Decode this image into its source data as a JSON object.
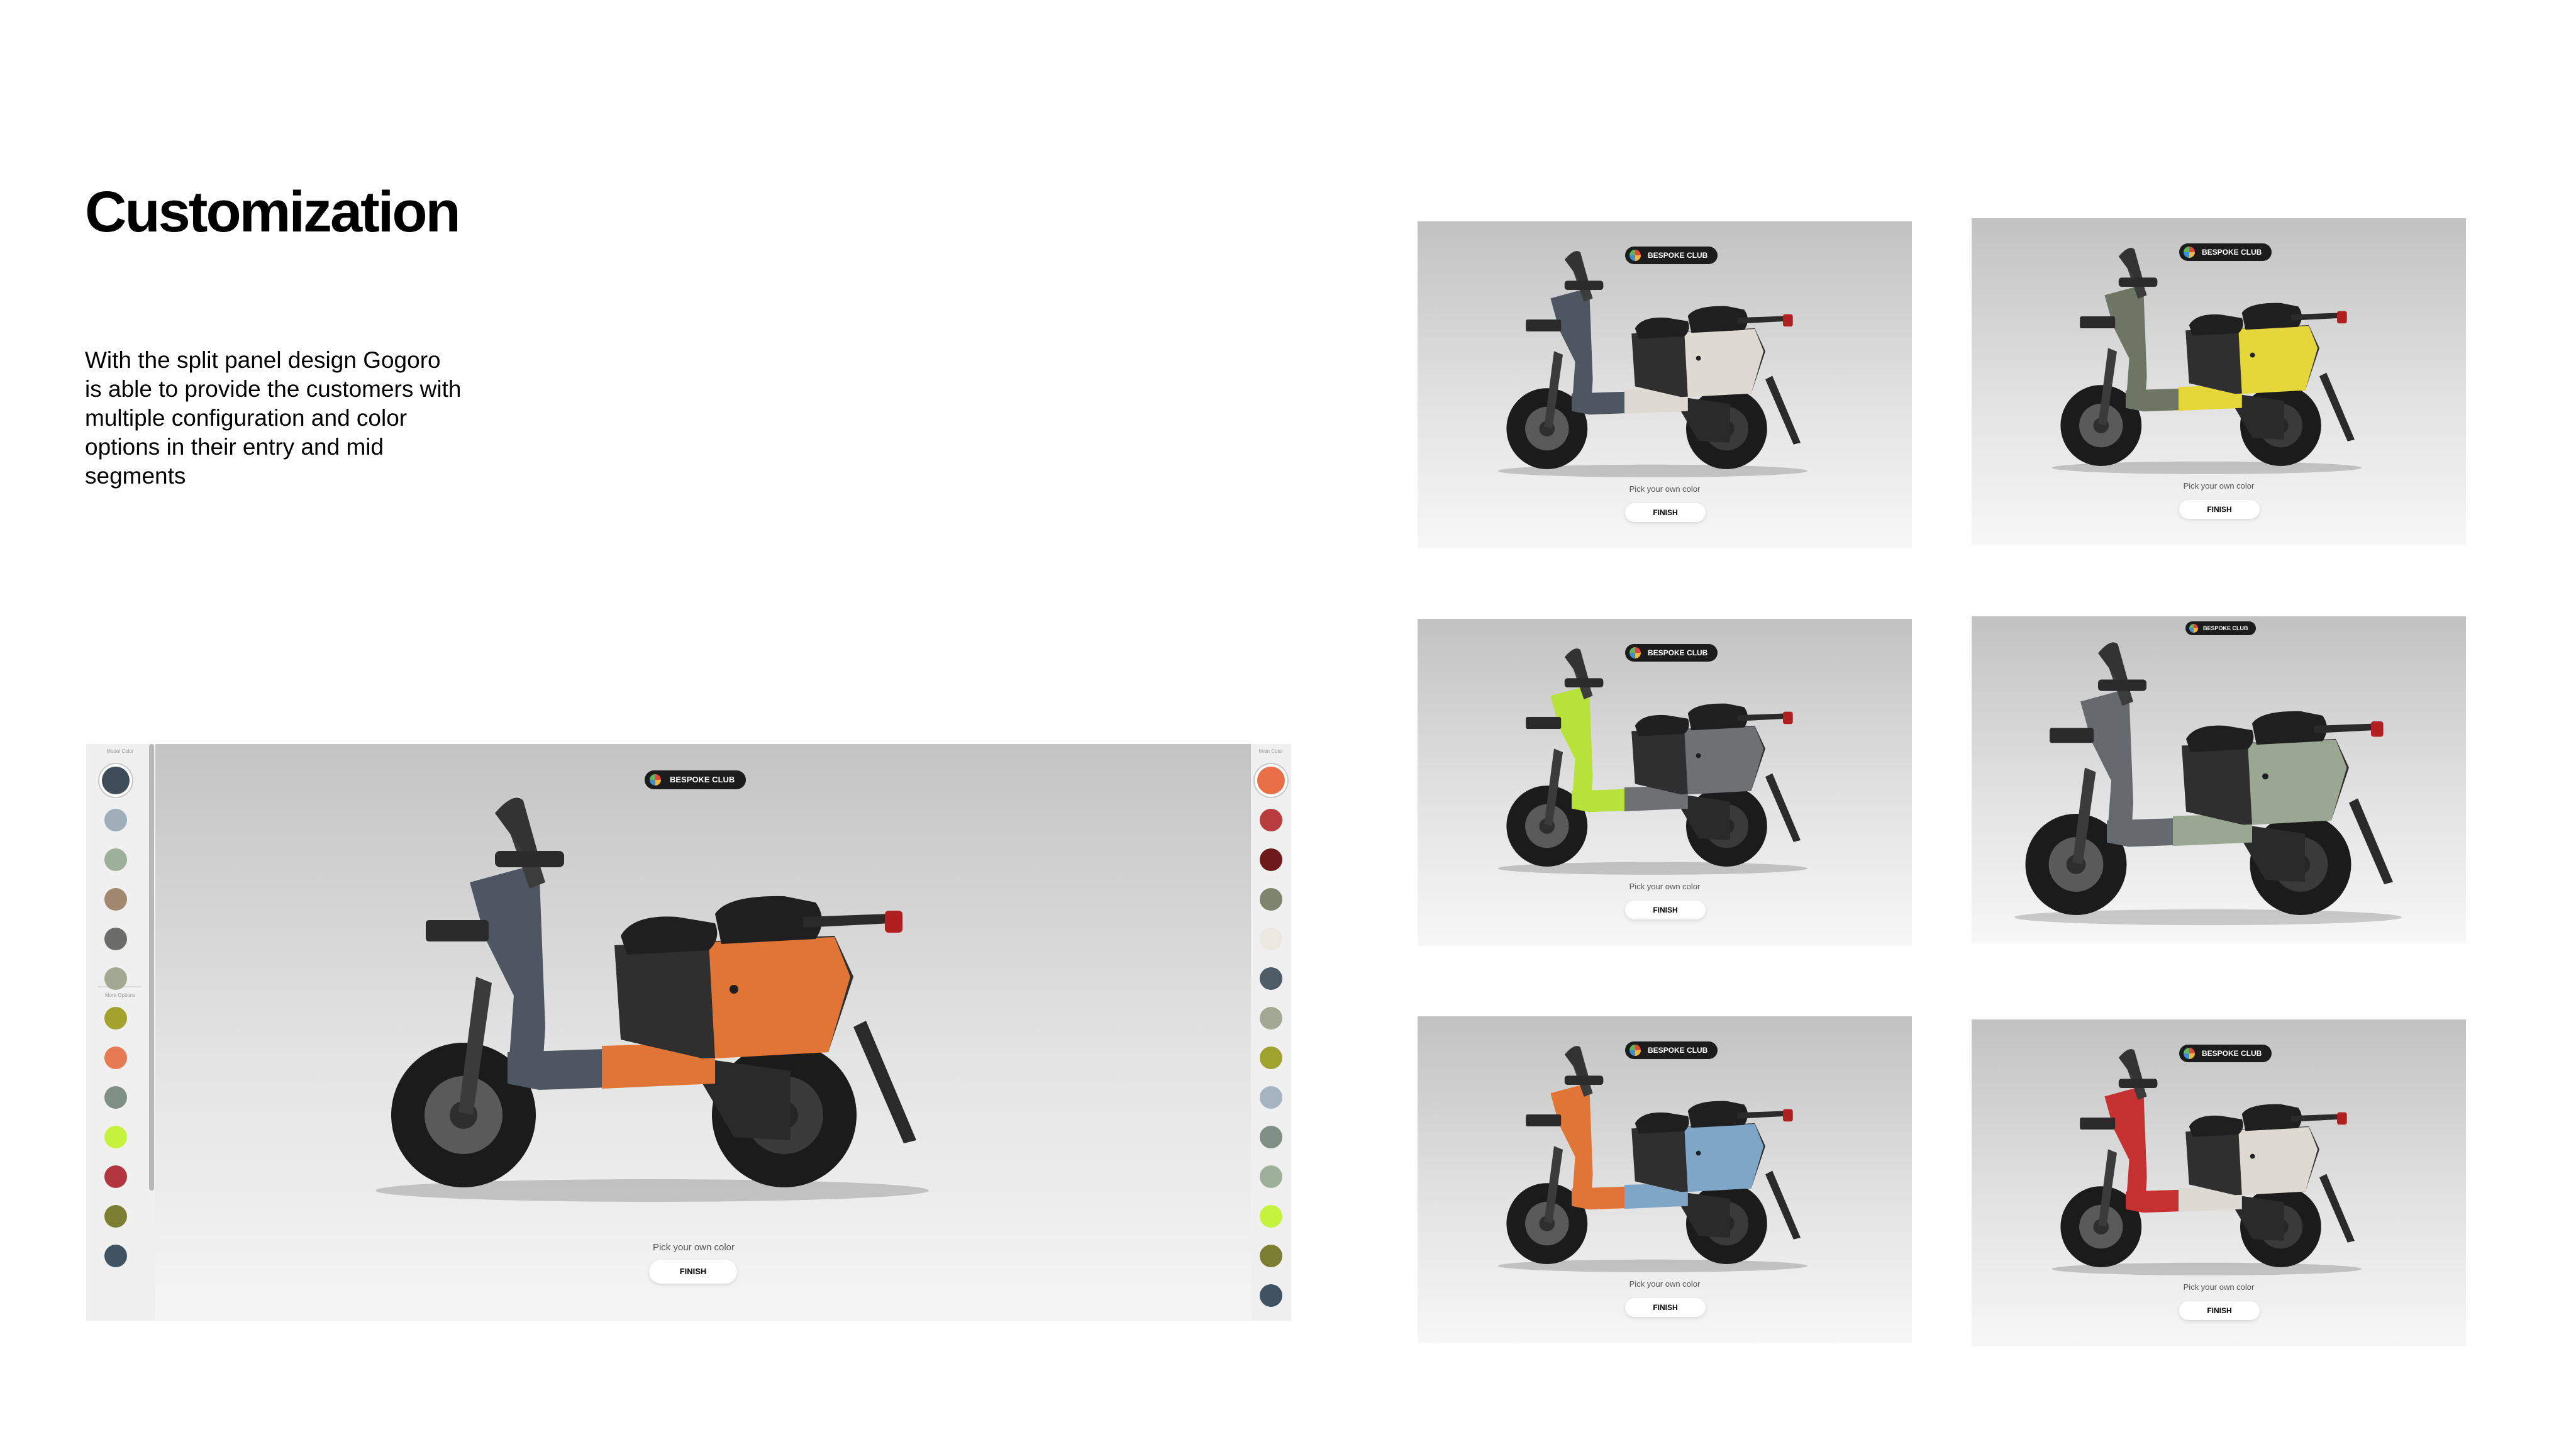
{
  "page": {
    "title": "Customization",
    "description": "With the split panel design Gogoro is able to provide the customers with multiple configuration and color options in their entry and mid segments"
  },
  "configurator": {
    "badge": "BESPOKE CLUB",
    "prompt": "Pick your own color",
    "finish": "FINISH",
    "left_label_top": "Model Color",
    "left_label_more": "More Options",
    "right_label": "Main Color",
    "left_swatches": [
      "#3e4d59",
      "#9fadb9",
      "#9fb09a",
      "#a38870",
      "#6c6c6a",
      "#a2a894",
      "#a3a22c",
      "#e67a52",
      "#7f8f86",
      "#c5f23c",
      "#b2363d",
      "#7c7f32",
      "#3f5363"
    ],
    "right_swatches": [
      "#e86f46",
      "#b93d3f",
      "#6e1a1a",
      "#7f846c",
      "#ebe8e1",
      "#4d5c66",
      "#a2a894",
      "#9fa22c",
      "#a6b4c2",
      "#7f8f86",
      "#9fb09a",
      "#c5f23c",
      "#7c7f32",
      "#3f5363"
    ],
    "scooter": {
      "body": "#4d5661",
      "panel": "#e07535"
    }
  },
  "variants": [
    {
      "badge": "BESPOKE CLUB",
      "prompt": "Pick your own color",
      "finish": "FINISH",
      "body": "#4d5661",
      "panel": "#dedad2"
    },
    {
      "badge": "BESPOKE CLUB",
      "prompt": "Pick your own color",
      "finish": "FINISH",
      "body": "#6f7565",
      "panel": "#e5d63a"
    },
    {
      "badge": "BESPOKE CLUB",
      "prompt": "Pick your own color",
      "finish": "FINISH",
      "body": "#b7e23a",
      "panel": "#6e7072"
    },
    {
      "badge": "BESPOKE CLUB",
      "prompt": "",
      "finish": "",
      "body": "#66696d",
      "panel": "#9aa792"
    },
    {
      "badge": "BESPOKE CLUB",
      "prompt": "Pick your own color",
      "finish": "FINISH",
      "body": "#e07535",
      "panel": "#7fa6c6"
    },
    {
      "badge": "BESPOKE CLUB",
      "prompt": "Pick your own color",
      "finish": "FINISH",
      "body": "#c53030",
      "panel": "#dedad2"
    }
  ]
}
